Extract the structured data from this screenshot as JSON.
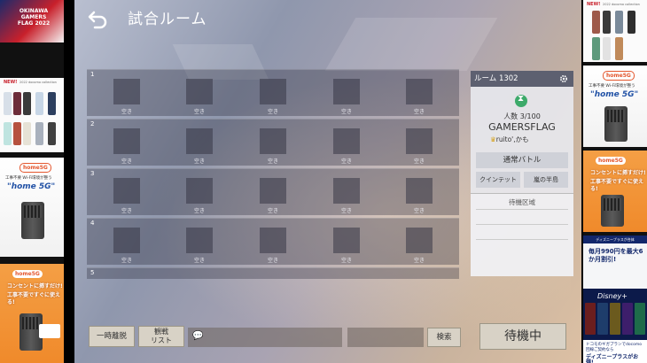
{
  "ads": {
    "okinawa": {
      "text": "OKINAWA GAMERS FLAG 2022"
    },
    "phones": {
      "badge": "NEW!",
      "subtitle": "2022 docomo collection"
    },
    "home5g": {
      "logo": "home5G",
      "line1": "工事不要 Wi-Fi環境が整う",
      "line2": "\"home 5G\""
    },
    "outlet": {
      "logo": "home5G",
      "line1": "コンセントに挿すだけ!",
      "line2": "工事不要ですぐに使える!"
    },
    "disney": {
      "header": "ディズニープラスが合体",
      "price": "毎月990円を最大6か月割引!",
      "brand": "Disney+",
      "footer": "ドコモのギガプランでdocomo回線ご契約なら",
      "footer_bold": "ディズニープラスがお得!"
    }
  },
  "game": {
    "title": "試合ルーム",
    "rows": [
      {
        "num": "1",
        "slots": [
          "空き",
          "空き",
          "空き",
          "空き",
          "空き"
        ]
      },
      {
        "num": "2",
        "slots": [
          "空き",
          "空き",
          "空き",
          "空き",
          "空き"
        ]
      },
      {
        "num": "3",
        "slots": [
          "空き",
          "空き",
          "空き",
          "空き",
          "空き"
        ]
      },
      {
        "num": "4",
        "slots": [
          "空き",
          "空き",
          "空き",
          "空き",
          "空き"
        ]
      },
      {
        "num": "5",
        "slots": []
      }
    ],
    "room": {
      "label": "ルーム 1302",
      "count": "人数 3/100",
      "name": "GAMERSFLAG",
      "host": "ruito',かも",
      "mode": "通常バトル",
      "rule": "クインテット",
      "stage": "嵐の半島",
      "waiting_area": "待機区域"
    },
    "buttons": {
      "leave": "一時離脱",
      "spectate_line1": "観戦",
      "spectate_line2": "リスト",
      "search": "検索",
      "standby": "待機中"
    }
  }
}
